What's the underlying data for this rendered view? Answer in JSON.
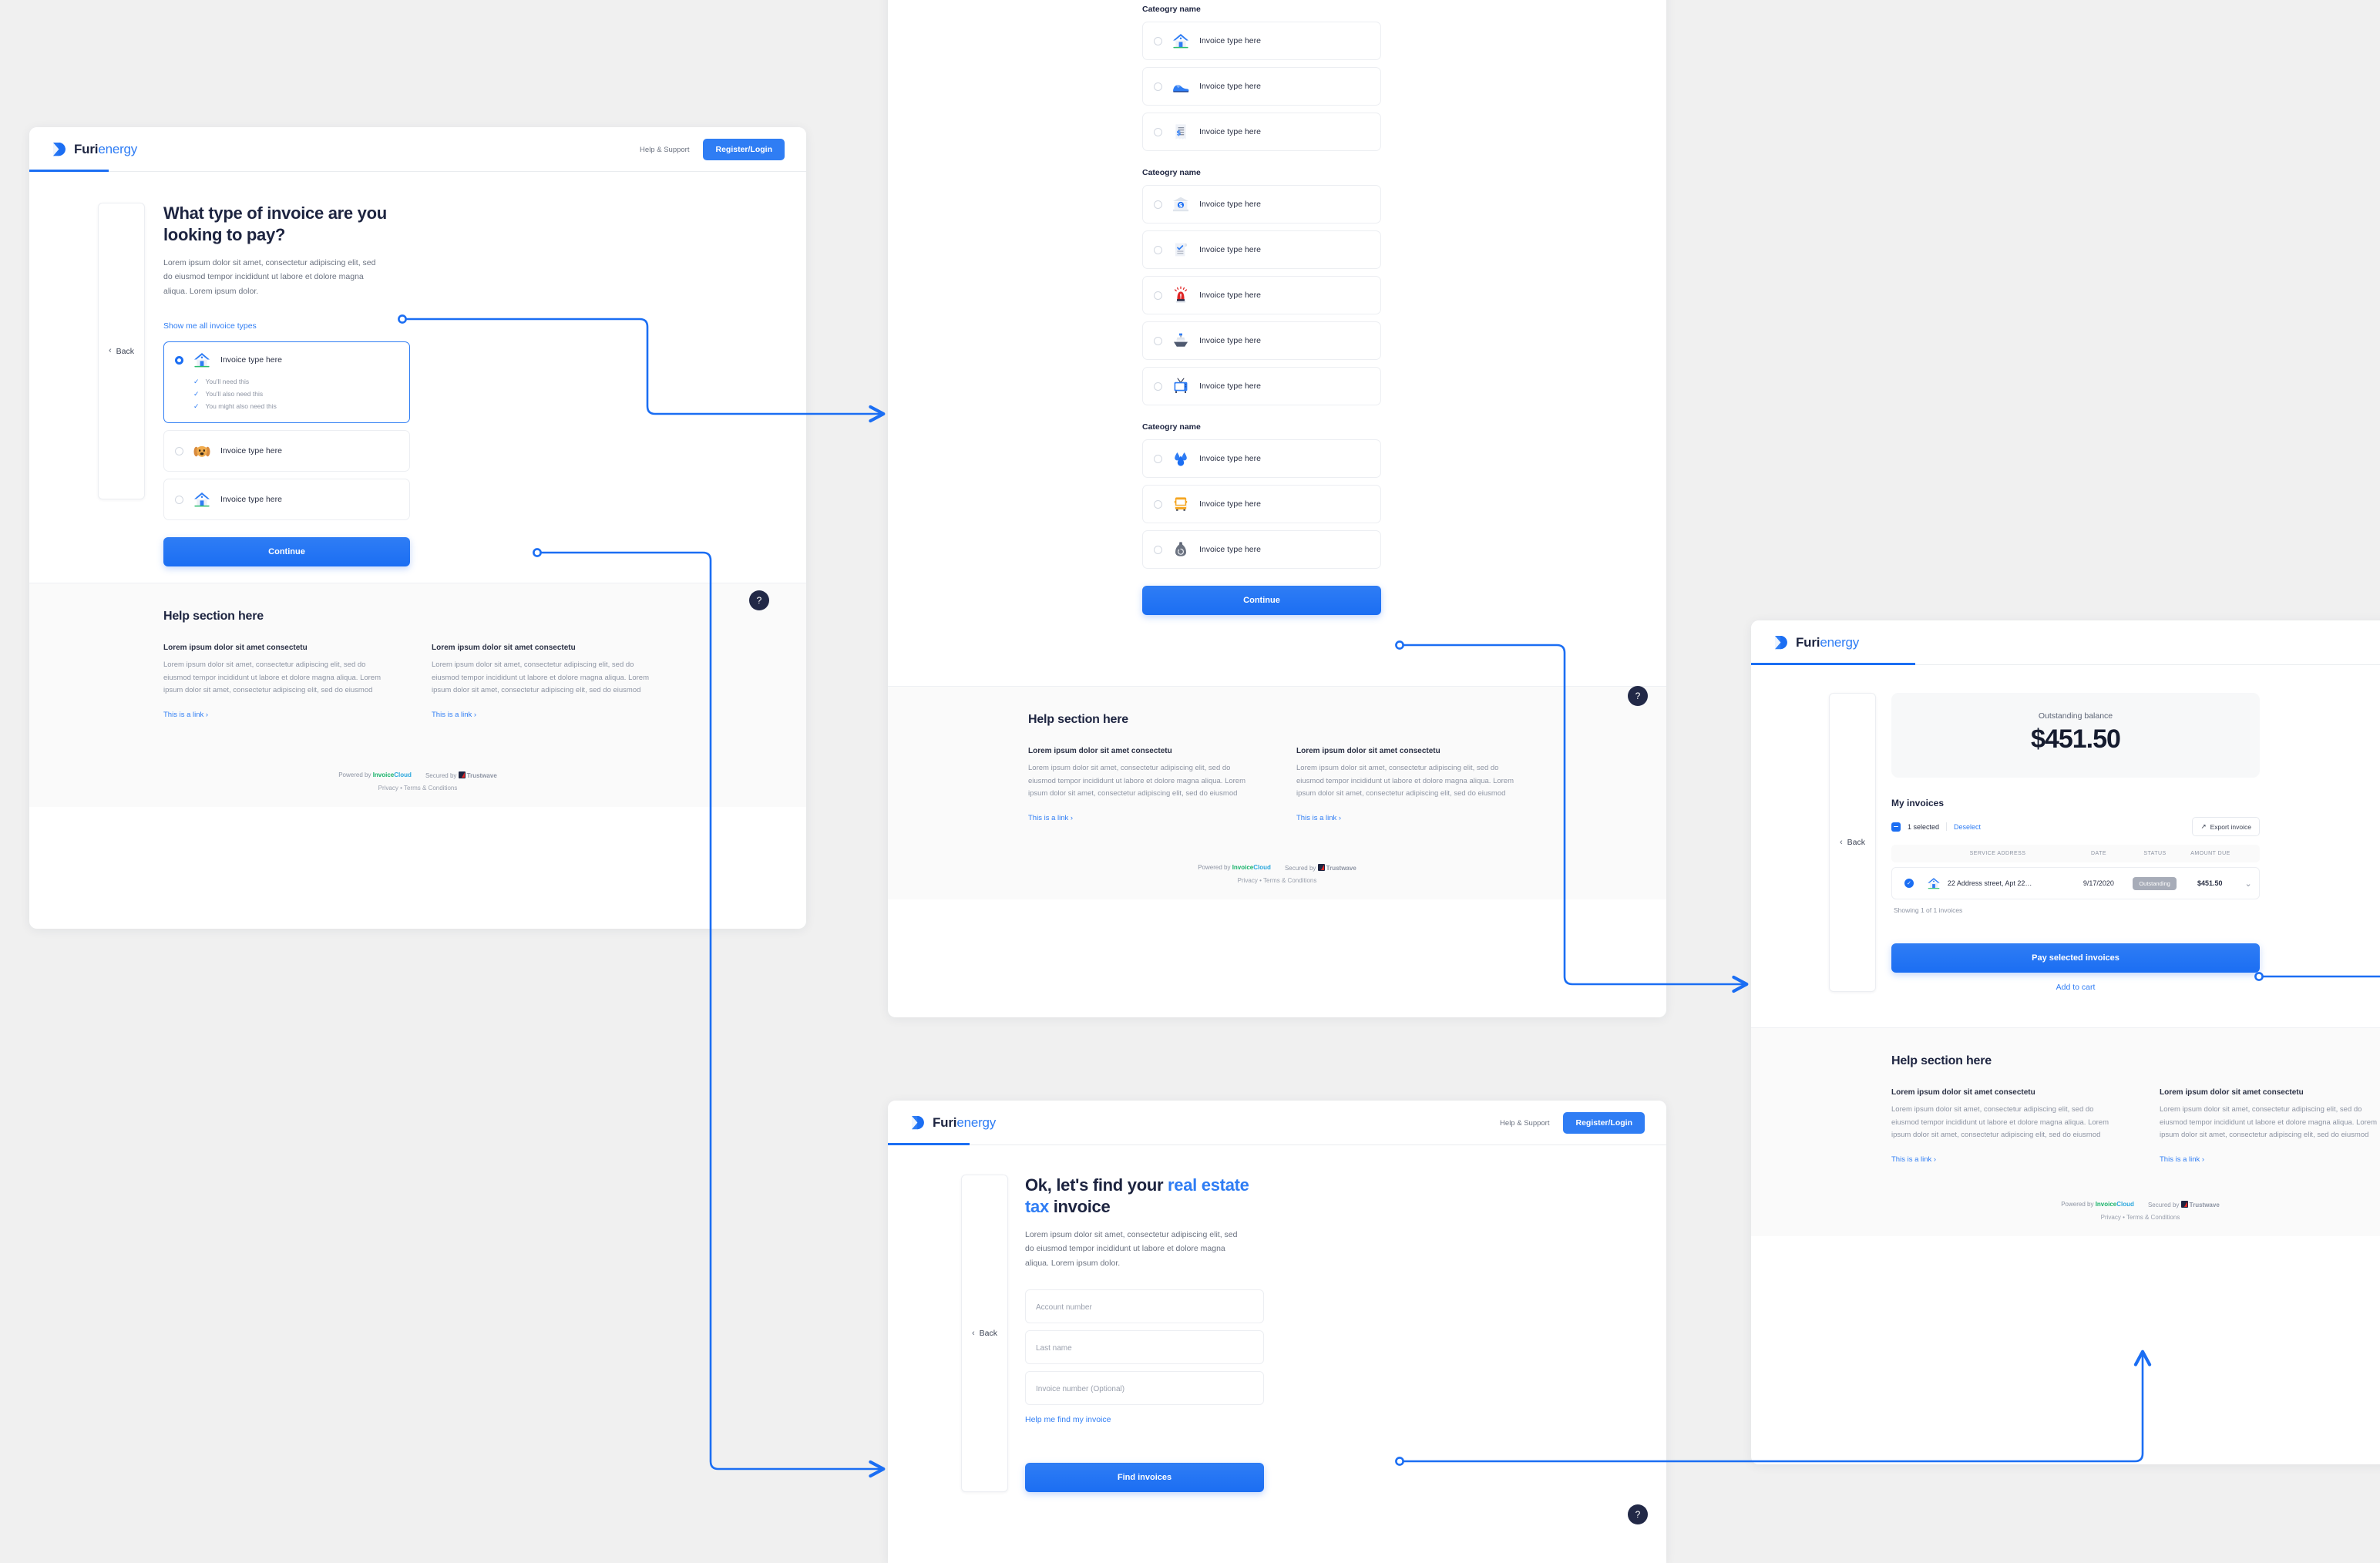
{
  "brand": {
    "name_bold": "Furi",
    "name_light": "energy"
  },
  "nav": {
    "help_support": "Help & Support",
    "register_login": "Register/Login"
  },
  "common": {
    "back": "Back",
    "chevron_left": "‹",
    "help_bubble": "?",
    "continue": "Continue",
    "help_heading": "Help section here",
    "help_card_title": "Lorem ipsum dolor sit amet consectetu",
    "help_card_body": "Lorem ipsum dolor sit amet, consectetur adipiscing elit, sed do eiusmod tempor incididunt ut labore et dolore magna aliqua. Lorem ipsum dolor sit amet, consectetur adipiscing elit, sed do eiusmod",
    "help_card_link": "This is a link ›",
    "footer_powered": "Powered by",
    "footer_invoice": "Invoice",
    "footer_cloud": "Cloud",
    "footer_secured": "Secured by",
    "footer_trustwave": "Trustwave",
    "footer_privacy": "Privacy",
    "footer_dot": "•",
    "footer_terms": "Terms & Conditions"
  },
  "screen1": {
    "title": "What type of invoice are you looking to pay?",
    "body": "Lorem ipsum dolor sit amet, consectetur adipiscing elit, sed do eiusmod tempor incididunt ut labore et dolore magna aliqua. Lorem ipsum dolor.",
    "show_all_link": "Show me all invoice types",
    "options": [
      {
        "label": "Invoice type here",
        "icon": "house-icon",
        "selected": true,
        "features": [
          "You'll need this",
          "You'll also need this",
          "You might also need this"
        ]
      },
      {
        "label": "Invoice type here",
        "icon": "dog-icon",
        "selected": false,
        "features": []
      },
      {
        "label": "Invoice type here",
        "icon": "house-icon",
        "selected": false,
        "features": []
      }
    ],
    "continue": "Continue"
  },
  "screen2": {
    "categories": [
      {
        "name": "Cateogry name",
        "items": [
          {
            "label": "Invoice type here",
            "icon": "house-icon"
          },
          {
            "label": "Invoice type here",
            "icon": "shoe-icon"
          },
          {
            "label": "Invoice type here",
            "icon": "receipt-icon"
          }
        ]
      },
      {
        "name": "Cateogry name",
        "items": [
          {
            "label": "Invoice type here",
            "icon": "bank-icon"
          },
          {
            "label": "Invoice type here",
            "icon": "document-check-icon"
          },
          {
            "label": "Invoice type here",
            "icon": "siren-icon"
          },
          {
            "label": "Invoice type here",
            "icon": "ship-icon"
          },
          {
            "label": "Invoice type here",
            "icon": "tv-icon"
          }
        ]
      },
      {
        "name": "Cateogry name",
        "items": [
          {
            "label": "Invoice type here",
            "icon": "water-drops-icon"
          },
          {
            "label": "Invoice type here",
            "icon": "school-bus-icon"
          },
          {
            "label": "Invoice type here",
            "icon": "trash-bag-icon"
          }
        ]
      }
    ],
    "continue": "Continue"
  },
  "screen3": {
    "title_pre": "Ok, let's find your ",
    "title_accent": "real estate tax",
    "title_post": " invoice",
    "body": "Lorem ipsum dolor sit amet, consectetur adipiscing elit, sed do eiusmod tempor incididunt ut labore et dolore magna aliqua. Lorem ipsum dolor.",
    "fields": [
      {
        "name": "account-number-field",
        "placeholder": "Account number",
        "value": ""
      },
      {
        "name": "last-name-field",
        "placeholder": "Last name",
        "value": ""
      },
      {
        "name": "invoice-number-field",
        "placeholder": "Invoice number (Optional)",
        "value": ""
      }
    ],
    "help_link": "Help me find my invoice",
    "submit": "Find invoices"
  },
  "screen4": {
    "balance_label": "Outstanding balance",
    "balance_amount": "$451.50",
    "my_invoices": "My invoices",
    "selected_count": "1 selected",
    "deselect": "Deselect",
    "export": "Export invoice",
    "export_icon": "↗",
    "columns": [
      "SERVICE ADDRESS",
      "DATE",
      "STATUS",
      "AMOUNT DUE"
    ],
    "rows": [
      {
        "checked": true,
        "icon": "house-icon",
        "service_address": "22 Address street, Apt 22…",
        "date": "9/17/2020",
        "status": "Outstanding",
        "amount_due": "$451.50",
        "expand_icon": "⌄"
      }
    ],
    "showing": "Showing 1 of 1 invoices",
    "pay_button": "Pay selected invoices",
    "add_to_cart": "Add to cart"
  },
  "colors": {
    "accent": "#2f7df4",
    "accent_deep": "#1b6ef3",
    "ink": "#1d2440",
    "muted": "#8d94a3",
    "canvas": "#f0f0f0",
    "bubble": "#222947",
    "badge_grey": "#a7acb8"
  }
}
